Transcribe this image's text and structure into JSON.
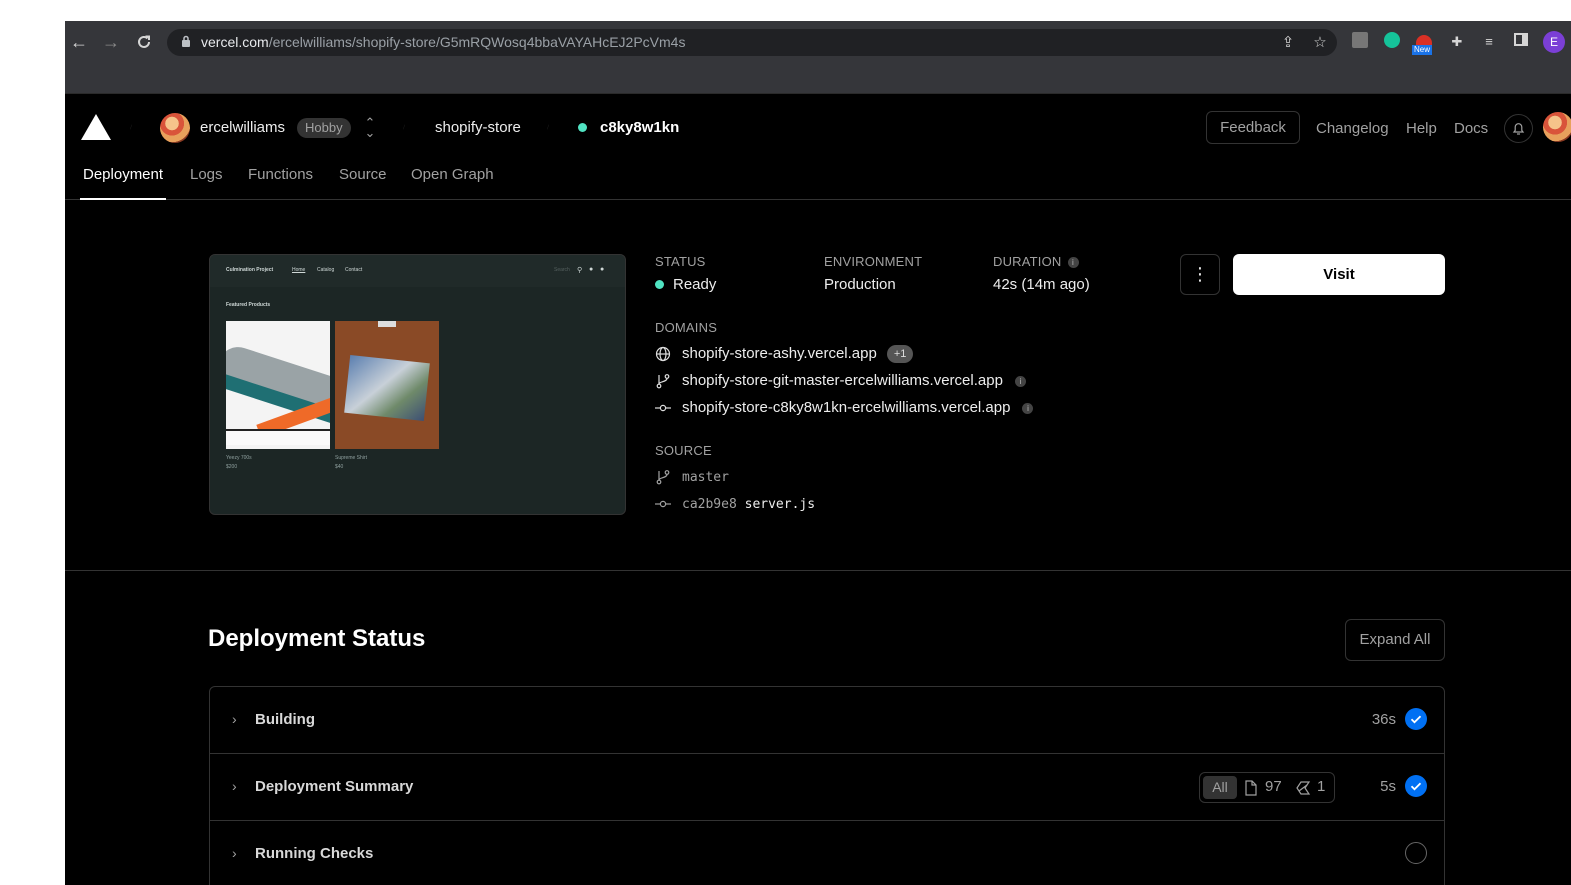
{
  "browser": {
    "url_host": "vercel.com",
    "url_path": "/ercelwilliams/shopify-store/G5mRQWosq4bbaVAYAHcEJ2PcVm4s",
    "profile_initial": "E",
    "new_badge": "New"
  },
  "header": {
    "team": "ercelwilliams",
    "plan": "Hobby",
    "project": "shopify-store",
    "deployment_id": "c8ky8w1kn",
    "feedback": "Feedback",
    "changelog": "Changelog",
    "help": "Help",
    "docs": "Docs"
  },
  "tabs": [
    "Deployment",
    "Logs",
    "Functions",
    "Source",
    "Open Graph"
  ],
  "preview": {
    "site_title": "Culmination Project",
    "nav": [
      "Home",
      "Catalog",
      "Contact"
    ],
    "search": "Search",
    "heading": "Featured Products",
    "products": [
      {
        "name": "Yeezy 700s",
        "price": "$200"
      },
      {
        "name": "Supreme Shirt",
        "price": "$40"
      }
    ]
  },
  "overview": {
    "status_label": "STATUS",
    "status": "Ready",
    "environment_label": "ENVIRONMENT",
    "environment": "Production",
    "duration_label": "DURATION",
    "duration": "42s (14m ago)",
    "visit": "Visit",
    "domains_label": "DOMAINS",
    "domains": [
      "shopify-store-ashy.vercel.app",
      "shopify-store-git-master-ercelwilliams.vercel.app",
      "shopify-store-c8ky8w1kn-ercelwilliams.vercel.app"
    ],
    "extra_domains": "+1",
    "source_label": "SOURCE",
    "branch": "master",
    "commit_hash": "ca2b9e8",
    "commit_message": "server.js"
  },
  "status_section": {
    "title": "Deployment Status",
    "expand_all": "Expand All",
    "rows": [
      {
        "title": "Building",
        "duration": "36s",
        "done": true
      },
      {
        "title": "Deployment Summary",
        "duration": "5s",
        "done": true
      },
      {
        "title": "Running Checks",
        "duration": "",
        "done": false
      }
    ],
    "filter": {
      "all": "All",
      "files": "97",
      "functions": "1"
    }
  },
  "colors": {
    "ready": "#50e3c2",
    "accent": "#0070f3",
    "background": "#000000"
  }
}
